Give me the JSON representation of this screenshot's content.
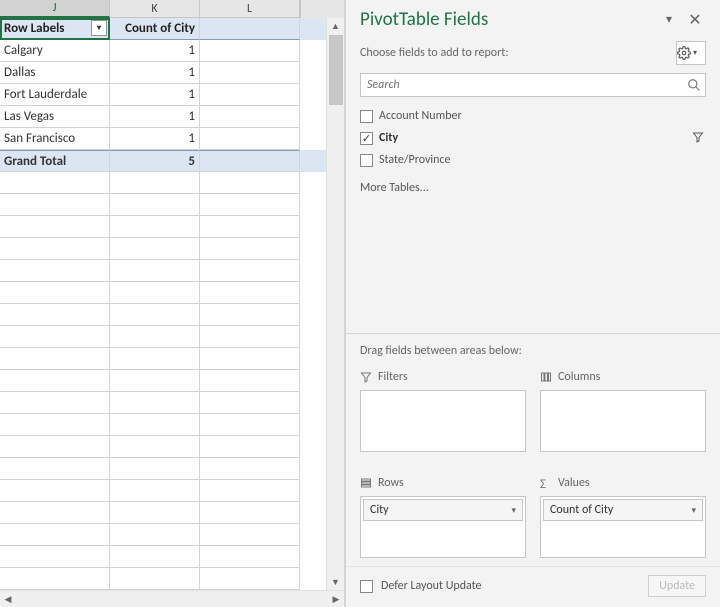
{
  "columns": {
    "j": "J",
    "k": "K",
    "l": "L"
  },
  "pivot": {
    "header": {
      "rowLabels": "Row Labels",
      "countLabel": "Count of City"
    },
    "rows": [
      {
        "label": "Calgary",
        "value": "1"
      },
      {
        "label": "Dallas",
        "value": "1"
      },
      {
        "label": "Fort Lauderdale",
        "value": "1"
      },
      {
        "label": "Las Vegas",
        "value": "1"
      },
      {
        "label": "San Francisco",
        "value": "1"
      }
    ],
    "grandTotal": {
      "label": "Grand Total",
      "value": "5"
    }
  },
  "pane": {
    "title": "PivotTable Fields",
    "prompt": "Choose fields to add to report:",
    "searchPlaceholder": "Search",
    "fields": [
      {
        "name": "Account Number",
        "checked": false
      },
      {
        "name": "City",
        "checked": true,
        "filtered": true
      },
      {
        "name": "State/Province",
        "checked": false
      }
    ],
    "moreTables": "More Tables...",
    "areasPrompt": "Drag fields between areas below:",
    "areas": {
      "filters": {
        "label": "Filters",
        "items": []
      },
      "columns": {
        "label": "Columns",
        "items": []
      },
      "rows": {
        "label": "Rows",
        "items": [
          "City"
        ]
      },
      "values": {
        "label": "Values",
        "items": [
          "Count of City"
        ]
      }
    },
    "defer": "Defer Layout Update",
    "update": "Update"
  }
}
